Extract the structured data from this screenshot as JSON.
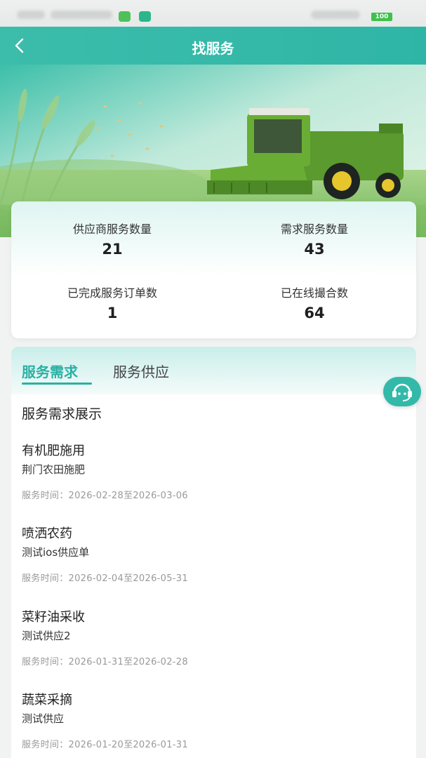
{
  "colors": {
    "brand": "#2ab0a3",
    "header": "#35b9a8",
    "battery": "#3ec14a"
  },
  "status_bar": {
    "battery": "100"
  },
  "header": {
    "title": "找服务",
    "back_icon": "chevron-left-icon"
  },
  "stats": [
    {
      "label": "供应商服务数量",
      "value": "21"
    },
    {
      "label": "需求服务数量",
      "value": "43"
    },
    {
      "label": "已完成服务订单数",
      "value": "1"
    },
    {
      "label": "已在线撮合数",
      "value": "64"
    }
  ],
  "tabs": [
    {
      "label": "服务需求",
      "active": true
    },
    {
      "label": "服务供应",
      "active": false
    }
  ],
  "section_title": "服务需求展示",
  "time_prefix": "服务时间：",
  "items": [
    {
      "title": "有机肥施用",
      "subtitle": "荆门农田施肥",
      "time": "2026-02-28至2026-03-06"
    },
    {
      "title": "喷洒农药",
      "subtitle": "测试ios供应单",
      "time": "2026-02-04至2026-05-31"
    },
    {
      "title": "菜籽油采收",
      "subtitle": "测试供应2",
      "time": "2026-01-31至2026-02-28"
    },
    {
      "title": "蔬菜采摘",
      "subtitle": "测试供应",
      "time": "2026-01-20至2026-01-31"
    }
  ],
  "float_button": {
    "icon": "customer-service-icon"
  }
}
